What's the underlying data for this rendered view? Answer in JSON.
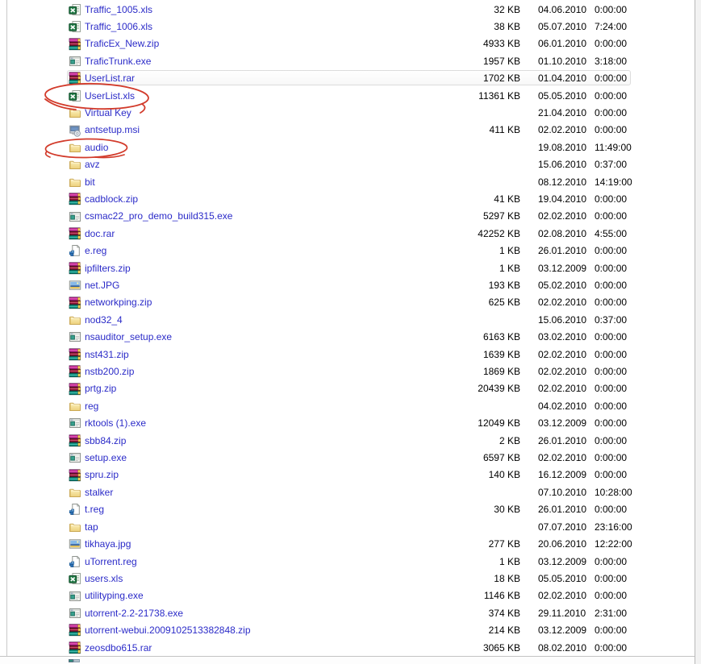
{
  "theme": {
    "background": "#ffffff",
    "filename_color": "#2b2bc8",
    "detail_text_color": "#000000",
    "annotation_red": "#d23a2a",
    "hover_border": "#dcdcdc",
    "pane_border": "#c3c3c3"
  },
  "file_list": {
    "rows": [
      {
        "name": "Traffic_1005.xls",
        "type": "excel",
        "icon": "excel-file-icon",
        "size": "32 KB",
        "date": "04.06.2010",
        "time": "0:00:00",
        "hovered": false,
        "annotated": false
      },
      {
        "name": "Traffic_1006.xls",
        "type": "excel",
        "icon": "excel-file-icon",
        "size": "38 KB",
        "date": "05.07.2010",
        "time": "7:24:00",
        "hovered": false,
        "annotated": false
      },
      {
        "name": "TraficEx_New.zip",
        "type": "winrar",
        "icon": "winrar-archive-icon",
        "size": "4933 KB",
        "date": "06.01.2010",
        "time": "0:00:00",
        "hovered": false,
        "annotated": false
      },
      {
        "name": "TraficTrunk.exe",
        "type": "app",
        "icon": "application-icon",
        "size": "1957 KB",
        "date": "01.10.2010",
        "time": "3:18:00",
        "hovered": false,
        "annotated": false
      },
      {
        "name": "UserList.rar",
        "type": "winrar",
        "icon": "winrar-archive-icon",
        "size": "1702 KB",
        "date": "01.04.2010",
        "time": "0:00:00",
        "hovered": true,
        "annotated": false
      },
      {
        "name": "UserList.xls",
        "type": "excel",
        "icon": "excel-file-icon",
        "size": "11361 KB",
        "date": "05.05.2010",
        "time": "0:00:00",
        "hovered": false,
        "annotated": true
      },
      {
        "name": "Virtual Key",
        "type": "folder",
        "icon": "folder-icon",
        "size": "",
        "date": "21.04.2010",
        "time": "0:00:00",
        "hovered": false,
        "annotated": false
      },
      {
        "name": "antsetup.msi",
        "type": "msi",
        "icon": "msi-installer-icon",
        "size": "411 KB",
        "date": "02.02.2010",
        "time": "0:00:00",
        "hovered": false,
        "annotated": false
      },
      {
        "name": "audio",
        "type": "folder",
        "icon": "folder-icon",
        "size": "",
        "date": "19.08.2010",
        "time": "11:49:00",
        "hovered": false,
        "annotated": true
      },
      {
        "name": "avz",
        "type": "folder",
        "icon": "folder-icon",
        "size": "",
        "date": "15.06.2010",
        "time": "0:37:00",
        "hovered": false,
        "annotated": false
      },
      {
        "name": "bit",
        "type": "folder",
        "icon": "folder-icon",
        "size": "",
        "date": "08.12.2010",
        "time": "14:19:00",
        "hovered": false,
        "annotated": false
      },
      {
        "name": "cadblock.zip",
        "type": "winrar",
        "icon": "winrar-archive-icon",
        "size": "41 KB",
        "date": "19.04.2010",
        "time": "0:00:00",
        "hovered": false,
        "annotated": false
      },
      {
        "name": "csmac22_pro_demo_build315.exe",
        "type": "app",
        "icon": "application-icon",
        "size": "5297 KB",
        "date": "02.02.2010",
        "time": "0:00:00",
        "hovered": false,
        "annotated": false
      },
      {
        "name": "doc.rar",
        "type": "winrar",
        "icon": "winrar-archive-icon",
        "size": "42252 KB",
        "date": "02.08.2010",
        "time": "4:55:00",
        "hovered": false,
        "annotated": false
      },
      {
        "name": "e.reg",
        "type": "reg",
        "icon": "registry-file-icon",
        "size": "1 KB",
        "date": "26.01.2010",
        "time": "0:00:00",
        "hovered": false,
        "annotated": false
      },
      {
        "name": "ipfilters.zip",
        "type": "winrar",
        "icon": "winrar-archive-icon",
        "size": "1 KB",
        "date": "03.12.2009",
        "time": "0:00:00",
        "hovered": false,
        "annotated": false
      },
      {
        "name": "net.JPG",
        "type": "image",
        "icon": "image-file-icon",
        "size": "193 KB",
        "date": "05.02.2010",
        "time": "0:00:00",
        "hovered": false,
        "annotated": false
      },
      {
        "name": "networkping.zip",
        "type": "winrar",
        "icon": "winrar-archive-icon",
        "size": "625 KB",
        "date": "02.02.2010",
        "time": "0:00:00",
        "hovered": false,
        "annotated": false
      },
      {
        "name": "nod32_4",
        "type": "folder",
        "icon": "folder-icon",
        "size": "",
        "date": "15.06.2010",
        "time": "0:37:00",
        "hovered": false,
        "annotated": false
      },
      {
        "name": "nsauditor_setup.exe",
        "type": "app",
        "icon": "application-icon",
        "size": "6163 KB",
        "date": "03.02.2010",
        "time": "0:00:00",
        "hovered": false,
        "annotated": false
      },
      {
        "name": "nst431.zip",
        "type": "winrar",
        "icon": "winrar-archive-icon",
        "size": "1639 KB",
        "date": "02.02.2010",
        "time": "0:00:00",
        "hovered": false,
        "annotated": false
      },
      {
        "name": "nstb200.zip",
        "type": "winrar",
        "icon": "winrar-archive-icon",
        "size": "1869 KB",
        "date": "02.02.2010",
        "time": "0:00:00",
        "hovered": false,
        "annotated": false
      },
      {
        "name": "prtg.zip",
        "type": "winrar",
        "icon": "winrar-archive-icon",
        "size": "20439 KB",
        "date": "02.02.2010",
        "time": "0:00:00",
        "hovered": false,
        "annotated": false
      },
      {
        "name": "reg",
        "type": "folder",
        "icon": "folder-icon",
        "size": "",
        "date": "04.02.2010",
        "time": "0:00:00",
        "hovered": false,
        "annotated": false
      },
      {
        "name": "rktools (1).exe",
        "type": "app",
        "icon": "application-icon",
        "size": "12049 KB",
        "date": "03.12.2009",
        "time": "0:00:00",
        "hovered": false,
        "annotated": false
      },
      {
        "name": "sbb84.zip",
        "type": "winrar",
        "icon": "winrar-archive-icon",
        "size": "2 KB",
        "date": "26.01.2010",
        "time": "0:00:00",
        "hovered": false,
        "annotated": false
      },
      {
        "name": "setup.exe",
        "type": "app",
        "icon": "application-icon",
        "size": "6597 KB",
        "date": "02.02.2010",
        "time": "0:00:00",
        "hovered": false,
        "annotated": false
      },
      {
        "name": "spru.zip",
        "type": "winrar",
        "icon": "winrar-archive-icon",
        "size": "140 KB",
        "date": "16.12.2009",
        "time": "0:00:00",
        "hovered": false,
        "annotated": false
      },
      {
        "name": "stalker",
        "type": "folder",
        "icon": "folder-icon",
        "size": "",
        "date": "07.10.2010",
        "time": "10:28:00",
        "hovered": false,
        "annotated": false
      },
      {
        "name": "t.reg",
        "type": "reg",
        "icon": "registry-file-icon",
        "size": "30 KB",
        "date": "26.01.2010",
        "time": "0:00:00",
        "hovered": false,
        "annotated": false
      },
      {
        "name": "tap",
        "type": "folder",
        "icon": "folder-icon",
        "size": "",
        "date": "07.07.2010",
        "time": "23:16:00",
        "hovered": false,
        "annotated": false
      },
      {
        "name": "tikhaya.jpg",
        "type": "image",
        "icon": "image-file-icon",
        "size": "277 KB",
        "date": "20.06.2010",
        "time": "12:22:00",
        "hovered": false,
        "annotated": false
      },
      {
        "name": "uTorrent.reg",
        "type": "reg",
        "icon": "registry-file-icon",
        "size": "1 KB",
        "date": "03.12.2009",
        "time": "0:00:00",
        "hovered": false,
        "annotated": false
      },
      {
        "name": "users.xls",
        "type": "excel",
        "icon": "excel-file-icon",
        "size": "18 KB",
        "date": "05.05.2010",
        "time": "0:00:00",
        "hovered": false,
        "annotated": false
      },
      {
        "name": "utilityping.exe",
        "type": "app",
        "icon": "application-icon",
        "size": "1146 KB",
        "date": "02.02.2010",
        "time": "0:00:00",
        "hovered": false,
        "annotated": false
      },
      {
        "name": "utorrent-2.2-21738.exe",
        "type": "app",
        "icon": "application-icon",
        "size": "374 KB",
        "date": "29.11.2010",
        "time": "2:31:00",
        "hovered": false,
        "annotated": false
      },
      {
        "name": "utorrent-webui.2009102513382848.zip",
        "type": "winrar",
        "icon": "winrar-archive-icon",
        "size": "214 KB",
        "date": "03.12.2009",
        "time": "0:00:00",
        "hovered": false,
        "annotated": false
      },
      {
        "name": "zeosdbo615.rar",
        "type": "winrar",
        "icon": "winrar-archive-icon",
        "size": "3065 KB",
        "date": "08.02.2010",
        "time": "0:00:00",
        "hovered": false,
        "annotated": false
      }
    ]
  },
  "annotations": [
    {
      "shape": "hand-drawn-ellipse",
      "target": "UserList.xls",
      "color": "#d23a2a"
    },
    {
      "shape": "hand-drawn-ellipse",
      "target": "audio",
      "color": "#d23a2a"
    }
  ]
}
